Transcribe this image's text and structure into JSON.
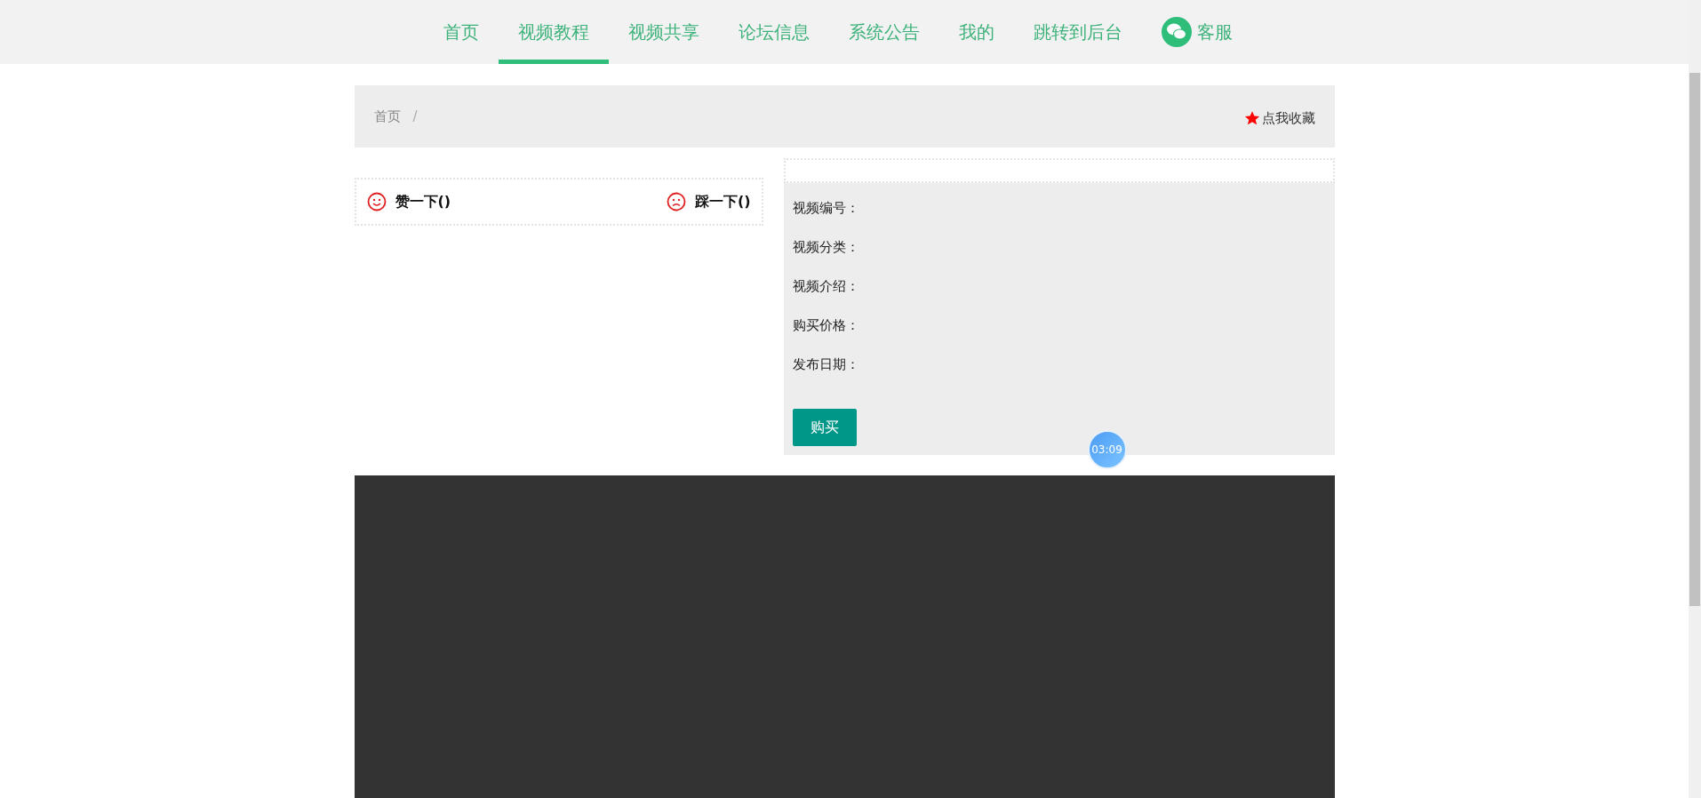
{
  "nav": {
    "items": [
      {
        "label": "首页",
        "selected": false
      },
      {
        "label": "视频教程",
        "selected": true
      },
      {
        "label": "视频共享",
        "selected": false
      },
      {
        "label": "论坛信息",
        "selected": false
      },
      {
        "label": "系统公告",
        "selected": false
      },
      {
        "label": "我的",
        "selected": false
      },
      {
        "label": "跳转到后台",
        "selected": false
      }
    ],
    "service": {
      "label": "客服"
    }
  },
  "breadcrumb": {
    "items": [
      "首页"
    ],
    "separator": "/"
  },
  "favorite": {
    "label": "点我收藏"
  },
  "votes": [
    {
      "kind": "like",
      "label": "赞一下()"
    },
    {
      "kind": "dislike",
      "label": "踩一下()"
    }
  ],
  "info": {
    "fields": [
      "视频编号：",
      "视频分类：",
      "视频介绍：",
      "购买价格：",
      "发布日期："
    ],
    "buy_button": "购买"
  },
  "timer_badge": "03:09"
}
